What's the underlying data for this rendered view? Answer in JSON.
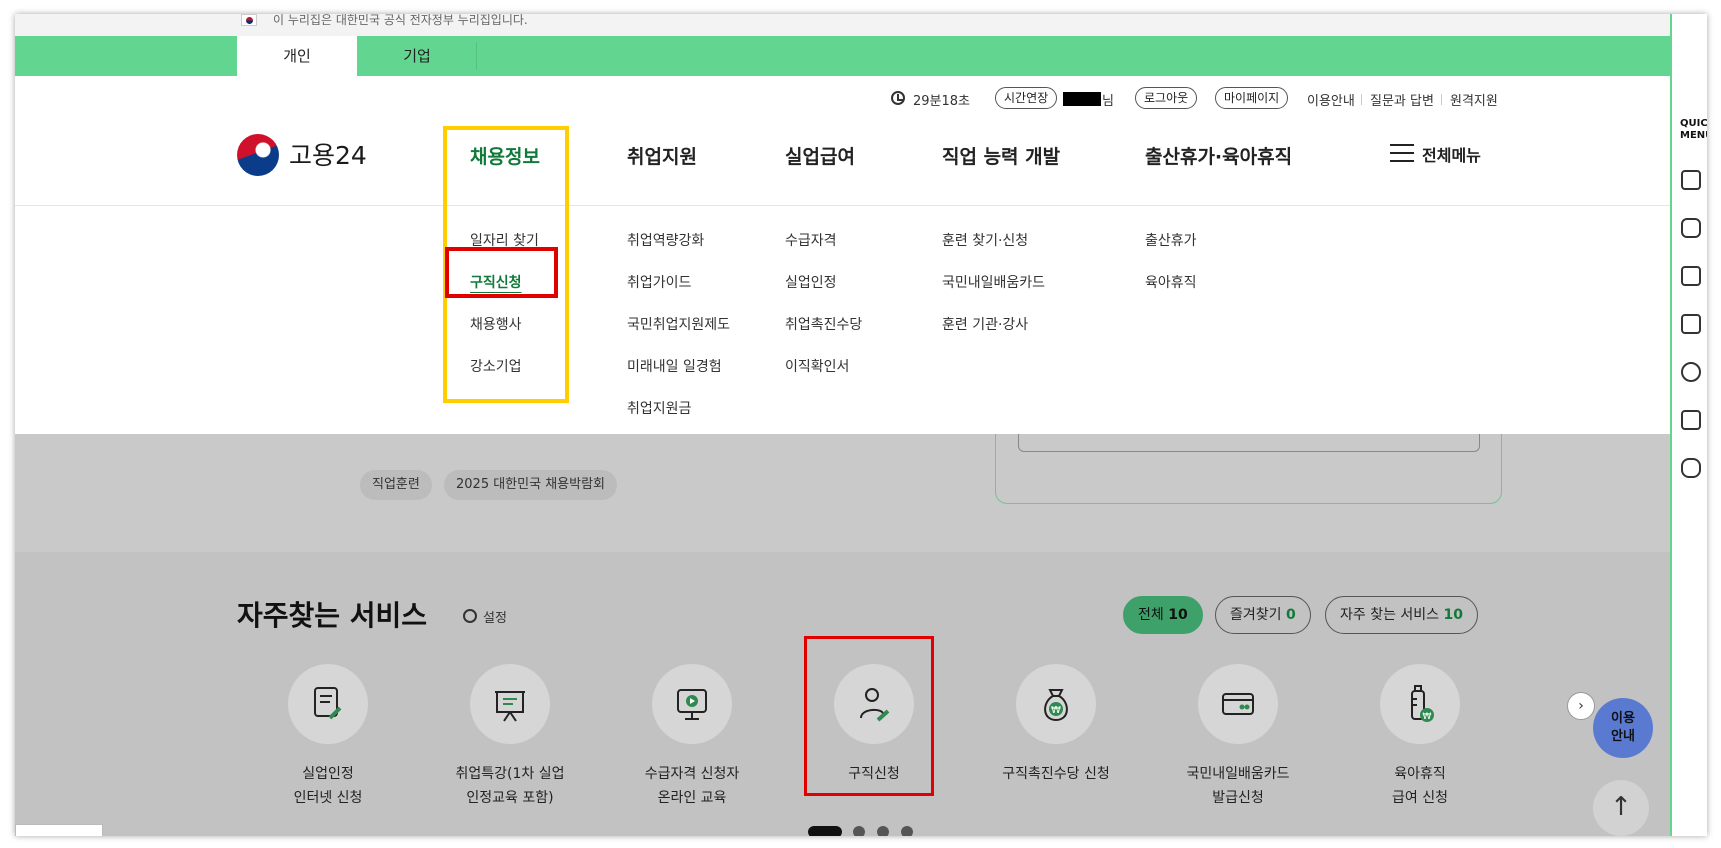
{
  "gov_banner": {
    "text": "이 누리집은 대한민국 공식 전자정부 누리집입니다."
  },
  "tabs": [
    {
      "label": "개인"
    },
    {
      "label": "기업"
    }
  ],
  "utility": {
    "timer": "29분18초",
    "extend": "시간연장",
    "nim": "님",
    "logout": "로그아웃",
    "mypage": "마이페이지",
    "guide": "이용안내",
    "qna": "질문과 답변",
    "remote": "원격지원"
  },
  "logo": {
    "text": "고용24"
  },
  "gnb": [
    {
      "label": "채용정보"
    },
    {
      "label": "취업지원"
    },
    {
      "label": "실업급여"
    },
    {
      "label": "직업 능력 개발"
    },
    {
      "label": "출산휴가·육아휴직"
    }
  ],
  "all_menu": "전체메뉴",
  "dropdown": {
    "col1": [
      "일자리 찾기",
      "구직신청",
      "채용행사",
      "강소기업"
    ],
    "col2": [
      "취업역량강화",
      "취업가이드",
      "국민취업지원제도",
      "미래내일 일경험",
      "취업지원금"
    ],
    "col3": [
      "수급자격",
      "실업인정",
      "취업촉진수당",
      "이직확인서"
    ],
    "col4": [
      "훈련 찾기·신청",
      "국민내일배움카드",
      "훈련 기관·강사"
    ],
    "col5": [
      "출산휴가",
      "육아휴직"
    ]
  },
  "chips": [
    "직업훈련",
    "2025 대한민국 채용박람회"
  ],
  "services_section": {
    "title": "자주찾는 서비스",
    "settings": "설정",
    "filters": [
      {
        "label": "전체",
        "count": "10"
      },
      {
        "label": "즐겨찾기",
        "count": "0"
      },
      {
        "label": "자주 찾는 서비스",
        "count": "10"
      }
    ],
    "items": [
      {
        "line1": "실업인정",
        "line2": "인터넷 신청",
        "icon": "document-pen-icon"
      },
      {
        "line1": "취업특강(1차 실업",
        "line2": "인정교육 포함)",
        "icon": "presentation-board-icon"
      },
      {
        "line1": "수급자격 신청자",
        "line2": "온라인 교육",
        "icon": "monitor-play-icon"
      },
      {
        "line1": "구직신청",
        "line2": "",
        "icon": "person-pen-icon"
      },
      {
        "line1": "구직촉진수당 신청",
        "line2": "",
        "icon": "money-bag-icon"
      },
      {
        "line1": "국민내일배움카드",
        "line2": "발급신청",
        "icon": "card-icon"
      },
      {
        "line1": "육아휴직",
        "line2": "급여 신청",
        "icon": "baby-bottle-icon"
      }
    ]
  },
  "help_button": {
    "line1": "이용",
    "line2": "안내"
  },
  "top_button": "↑",
  "next_arrow": "›",
  "quick_menu": {
    "title_line1": "QUIC",
    "title_line2": "MENU"
  },
  "colors": {
    "brand_green": "#62d591",
    "active_green": "#117a3a",
    "highlight_yellow": "#ffcd00",
    "highlight_red": "#e00000"
  }
}
